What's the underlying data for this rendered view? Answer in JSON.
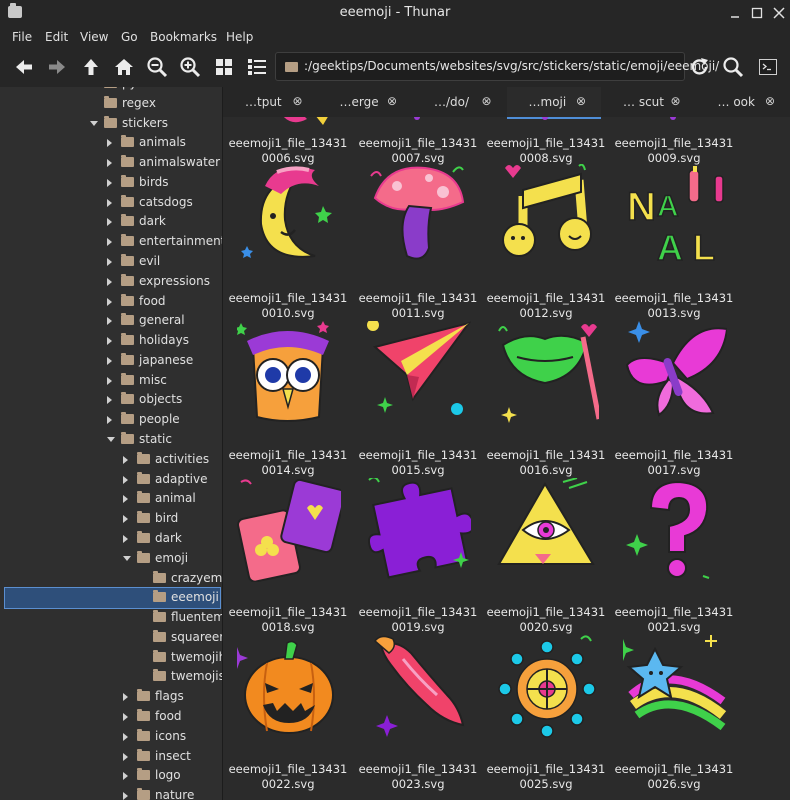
{
  "window": {
    "title": "eeemoji - Thunar"
  },
  "menu": [
    "File",
    "Edit",
    "View",
    "Go",
    "Bookmarks",
    "Help"
  ],
  "location": {
    "path": ":/geektips/Documents/websites/svg/src/stickers/static/emoji/eeemoji/"
  },
  "sidebar": {
    "items": [
      {
        "label": "python",
        "level": 0,
        "arrow": "none"
      },
      {
        "label": "regex",
        "level": 0,
        "arrow": "none"
      },
      {
        "label": "stickers",
        "level": 0,
        "arrow": "down"
      },
      {
        "label": "animals",
        "level": 1,
        "arrow": "right"
      },
      {
        "label": "animalswater",
        "level": 1,
        "arrow": "right"
      },
      {
        "label": "birds",
        "level": 1,
        "arrow": "right"
      },
      {
        "label": "catsdogs",
        "level": 1,
        "arrow": "right"
      },
      {
        "label": "dark",
        "level": 1,
        "arrow": "right"
      },
      {
        "label": "entertainment",
        "level": 1,
        "arrow": "right"
      },
      {
        "label": "evil",
        "level": 1,
        "arrow": "right"
      },
      {
        "label": "expressions",
        "level": 1,
        "arrow": "right"
      },
      {
        "label": "food",
        "level": 1,
        "arrow": "right"
      },
      {
        "label": "general",
        "level": 1,
        "arrow": "right"
      },
      {
        "label": "holidays",
        "level": 1,
        "arrow": "right"
      },
      {
        "label": "japanese",
        "level": 1,
        "arrow": "right"
      },
      {
        "label": "misc",
        "level": 1,
        "arrow": "right"
      },
      {
        "label": "objects",
        "level": 1,
        "arrow": "right"
      },
      {
        "label": "people",
        "level": 1,
        "arrow": "right"
      },
      {
        "label": "static",
        "level": 1,
        "arrow": "down"
      },
      {
        "label": "activities",
        "level": 2,
        "arrow": "right"
      },
      {
        "label": "adaptive",
        "level": 2,
        "arrow": "right"
      },
      {
        "label": "animal",
        "level": 2,
        "arrow": "right"
      },
      {
        "label": "bird",
        "level": 2,
        "arrow": "right"
      },
      {
        "label": "dark",
        "level": 2,
        "arrow": "right"
      },
      {
        "label": "emoji",
        "level": 2,
        "arrow": "down"
      },
      {
        "label": "crazyemo",
        "level": 3,
        "arrow": "none"
      },
      {
        "label": "eeemoji",
        "level": 3,
        "arrow": "none",
        "selected": true
      },
      {
        "label": "fluenteme",
        "level": 3,
        "arrow": "none"
      },
      {
        "label": "squareem",
        "level": 3,
        "arrow": "none"
      },
      {
        "label": "twemojiha",
        "level": 3,
        "arrow": "none"
      },
      {
        "label": "twemojisr",
        "level": 3,
        "arrow": "none"
      },
      {
        "label": "flags",
        "level": 2,
        "arrow": "right"
      },
      {
        "label": "food",
        "level": 2,
        "arrow": "right"
      },
      {
        "label": "icons",
        "level": 2,
        "arrow": "right"
      },
      {
        "label": "insect",
        "level": 2,
        "arrow": "right"
      },
      {
        "label": "logo",
        "level": 2,
        "arrow": "right"
      },
      {
        "label": "nature",
        "level": 2,
        "arrow": "right"
      }
    ]
  },
  "tabs": [
    {
      "label": "…tput"
    },
    {
      "label": "…erge"
    },
    {
      "label": "…/do/"
    },
    {
      "label": "…moji",
      "active": true
    },
    {
      "label": "… scut"
    },
    {
      "label": "… ook"
    }
  ],
  "files": [
    {
      "line1": "eeemoji1_file_13431",
      "line2": "0006.svg",
      "icon": "crescent-sticker"
    },
    {
      "line1": "eeemoji1_file_13431",
      "line2": "0007.svg",
      "icon": "sticker"
    },
    {
      "line1": "eeemoji1_file_13431",
      "line2": "0008.svg",
      "icon": "sticker"
    },
    {
      "line1": "eeemoji1_file_13431",
      "line2": "0009.svg",
      "icon": "sticker"
    },
    {
      "line1": "eeemoji1_file_13431",
      "line2": "0010.svg",
      "icon": "moon-icon"
    },
    {
      "line1": "eeemoji1_file_13431",
      "line2": "0011.svg",
      "icon": "mushroom-icon"
    },
    {
      "line1": "eeemoji1_file_13431",
      "line2": "0012.svg",
      "icon": "music-note-icon"
    },
    {
      "line1": "eeemoji1_file_13431",
      "line2": "0013.svg",
      "icon": "nail-text-icon"
    },
    {
      "line1": "eeemoji1_file_13431",
      "line2": "0014.svg",
      "icon": "owl-icon"
    },
    {
      "line1": "eeemoji1_file_13431",
      "line2": "0015.svg",
      "icon": "paper-plane-icon"
    },
    {
      "line1": "eeemoji1_file_13431",
      "line2": "0016.svg",
      "icon": "lips-mask-icon"
    },
    {
      "line1": "eeemoji1_file_13431",
      "line2": "0017.svg",
      "icon": "butterfly-icon"
    },
    {
      "line1": "eeemoji1_file_13431",
      "line2": "0018.svg",
      "icon": "playing-cards-icon"
    },
    {
      "line1": "eeemoji1_file_13431",
      "line2": "0019.svg",
      "icon": "puzzle-icon"
    },
    {
      "line1": "eeemoji1_file_13431",
      "line2": "0020.svg",
      "icon": "pyramid-eye-icon"
    },
    {
      "line1": "eeemoji1_file_13431",
      "line2": "0021.svg",
      "icon": "question-mark-icon"
    },
    {
      "line1": "eeemoji1_file_13431",
      "line2": "0022.svg",
      "icon": "pumpkin-icon"
    },
    {
      "line1": "eeemoji1_file_13431",
      "line2": "0023.svg",
      "icon": "chili-pepper-icon"
    },
    {
      "line1": "eeemoji1_file_13431",
      "line2": "0025.svg",
      "icon": "ship-wheel-icon"
    },
    {
      "line1": "eeemoji1_file_13431",
      "line2": "0026.svg",
      "icon": "shooting-star-icon"
    }
  ]
}
